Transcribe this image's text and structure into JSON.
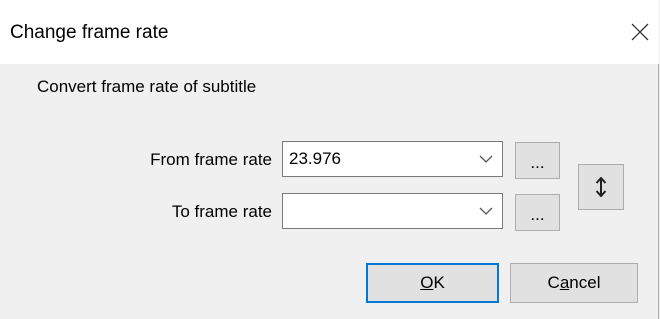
{
  "dialog": {
    "title": "Change frame rate",
    "description": "Convert frame rate of subtitle"
  },
  "from": {
    "label": "From frame rate",
    "value": "23.976",
    "browse_label": "..."
  },
  "to": {
    "label": "To frame rate",
    "value": "",
    "browse_label": "..."
  },
  "buttons": {
    "ok_mnemonic": "O",
    "ok_rest": "K",
    "cancel_pre": "C",
    "cancel_mnemonic": "a",
    "cancel_rest": "ncel"
  },
  "icons": {
    "close": "close-icon",
    "swap": "swap-vertical-icon",
    "dropdown": "chevron-down-icon"
  },
  "colors": {
    "accent": "#0078d7",
    "dialog_bg": "#f0f0f0",
    "title_bg": "#ffffff"
  }
}
